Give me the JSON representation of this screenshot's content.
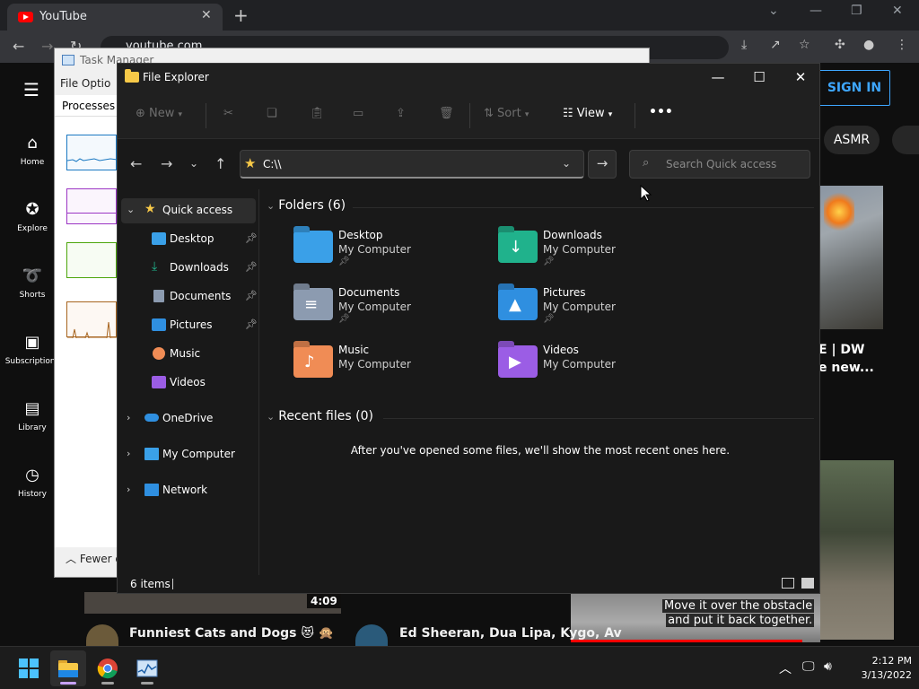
{
  "chrome": {
    "tab_title": "YouTube",
    "url": "youtube.com"
  },
  "youtube": {
    "nav": [
      {
        "label": "Home",
        "icon": "home-icon"
      },
      {
        "label": "Explore",
        "icon": "compass-icon"
      },
      {
        "label": "Shorts",
        "icon": "shorts-icon"
      },
      {
        "label": "Subscriptions",
        "icon": "subscriptions-icon"
      },
      {
        "label": "Library",
        "icon": "library-icon"
      },
      {
        "label": "History",
        "icon": "history-icon"
      }
    ],
    "signin_label": "SIGN IN",
    "chip_asmr": "ASMR",
    "video_title_partial_1": "E | DW",
    "video_title_partial_2": "e new...",
    "duration": "4:09",
    "caption_line1": "Move it over the obstacle",
    "caption_line2": "and put it back together.",
    "video_title_cats": "Funniest Cats and Dogs 😻 🙊",
    "video_title_music": "Ed Sheeran, Dua Lipa, Kygo, Av"
  },
  "task_manager": {
    "title": "Task Manager",
    "menu": "File   Optio",
    "tab": "Processes",
    "fewer": "Fewer d"
  },
  "explorer": {
    "title": "File Explorer",
    "toolbar": {
      "new": "New",
      "sort": "Sort",
      "view": "View",
      "more": "•••"
    },
    "address": "C:\\\\",
    "search_placeholder": "Search Quick access",
    "sidebar": [
      {
        "label": "Quick access",
        "pinned": false
      },
      {
        "label": "Desktop",
        "pinned": true
      },
      {
        "label": "Downloads",
        "pinned": true
      },
      {
        "label": "Documents",
        "pinned": true
      },
      {
        "label": "Pictures",
        "pinned": true
      },
      {
        "label": "Music",
        "pinned": false
      },
      {
        "label": "Videos",
        "pinned": false
      },
      {
        "label": "OneDrive",
        "pinned": false
      },
      {
        "label": "My Computer",
        "pinned": false
      },
      {
        "label": "Network",
        "pinned": false
      }
    ],
    "folders_header": "Folders (6)",
    "folders": [
      {
        "name": "Desktop",
        "location": "My Computer",
        "pinned": true,
        "color": "#3aa0e8"
      },
      {
        "name": "Downloads",
        "location": "My Computer",
        "pinned": true,
        "color": "#20b28c"
      },
      {
        "name": "Documents",
        "location": "My Computer",
        "pinned": true,
        "color": "#8c9bb0"
      },
      {
        "name": "Pictures",
        "location": "My Computer",
        "pinned": true,
        "color": "#2f8fe0"
      },
      {
        "name": "Music",
        "location": "My Computer",
        "pinned": false,
        "color": "#f08c55"
      },
      {
        "name": "Videos",
        "location": "My Computer",
        "pinned": false,
        "color": "#9b5de5"
      }
    ],
    "recent_header": "Recent files (0)",
    "recent_empty": "After you've opened some files, we'll show the most recent ones here.",
    "status_count": "6 items"
  },
  "taskbar": {
    "time": "2:12 PM",
    "date": "3/13/2022"
  }
}
